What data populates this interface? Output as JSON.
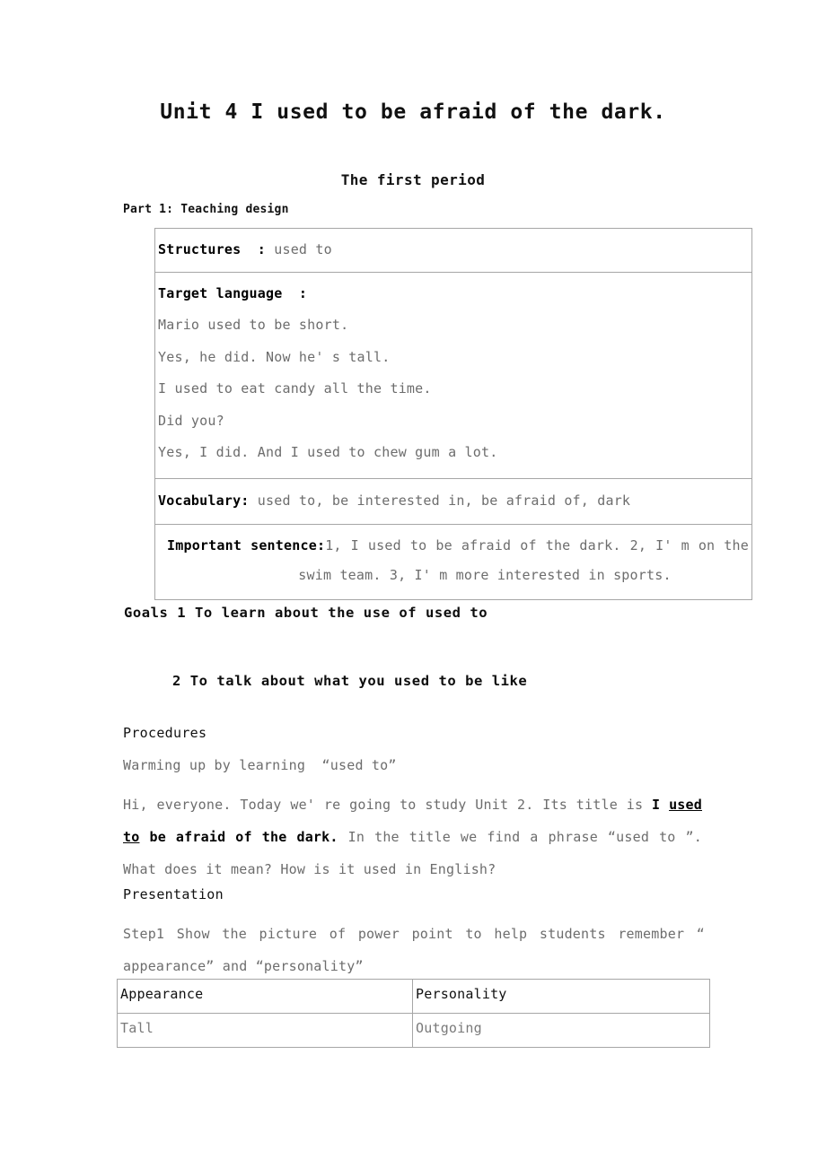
{
  "document": {
    "title": "Unit 4 I used to be afraid of the dark.",
    "subtitle": "The first period",
    "part_label": "Part 1: Teaching design"
  },
  "design_table": {
    "structures": {
      "label": "Structures  :",
      "value": " used to"
    },
    "target_language": {
      "label": "Target language  :",
      "lines": [
        "Mario used to be short.",
        "Yes, he did. Now he' s tall.",
        "I used to eat candy all the time.",
        "Did you?",
        "Yes, I did. And I used to chew gum a lot."
      ]
    },
    "vocabulary": {
      "label": "Vocabulary:",
      "value": " used to, be interested in, be afraid of, dark"
    },
    "important_sentence": {
      "label": "Important sentence:",
      "line1": "1, I used to be afraid of the dark. 2, I' m on the",
      "line2": "swim team. 3, I' m more interested in sports."
    }
  },
  "goals": {
    "line1": "Goals 1 To learn about the use of used to",
    "line2": "2 To talk about what you used to be like"
  },
  "procedures": {
    "heading": "Procedures",
    "warming_up": "Warming up by learning  “used to”",
    "intro": {
      "line1_a": "Hi, everyone. Today we' re going to study Unit 2. Its title is ",
      "line1_bold": "I ",
      "line1_bold_underline": "used",
      "line2_bold_underline": "to",
      "line2_bold": " be afraid of the dark.",
      "line2_rest": " In the title we find a phrase  “used to ”.",
      "line3": "What does it mean? How is it used in English?"
    }
  },
  "presentation": {
    "heading": "Presentation",
    "step1_line1": "Step1 Show the picture of power point to help students remember  “",
    "step1_line2": "appearance”  and  “personality”"
  },
  "appearance_table": {
    "headers": [
      "Appearance",
      "Personality"
    ],
    "rows": [
      [
        "Tall",
        "Outgoing"
      ]
    ]
  }
}
